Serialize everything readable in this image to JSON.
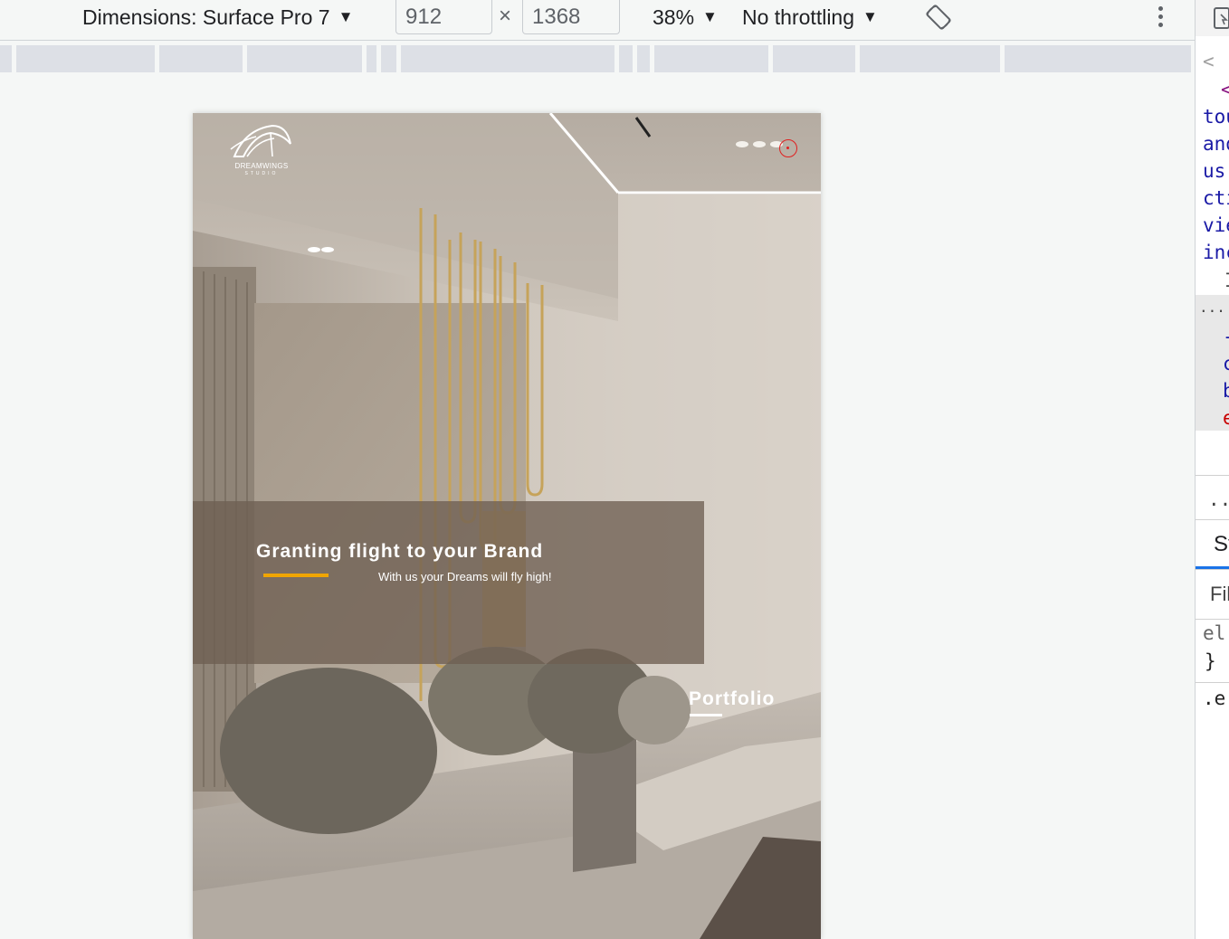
{
  "toolbar": {
    "device_label": "Dimensions: Surface Pro 7",
    "width_value": "912",
    "height_value": "1368",
    "times_symbol": "×",
    "zoom_label": "38%",
    "throttle_label": "No throttling",
    "caret": "▼"
  },
  "page": {
    "logo_text": "DREAMWINGS",
    "logo_subtext": "STUDIO",
    "hero_title": "Granting flight to your Brand",
    "hero_subtitle": "With us your Dreams will fly high!",
    "portfolio_label": "Portfolio",
    "colors": {
      "accent": "#f0a500",
      "overlay": "#6e5f52",
      "text": "#ffffff"
    }
  },
  "devtools_panel": {
    "code_lines": [
      "<",
      "<",
      "tou",
      "and",
      "us",
      "cti",
      "vie",
      "inc",
      "I",
      "...",
      "-",
      "c",
      "b",
      "e"
    ],
    "ellipsis": "..",
    "styles_tab_fragment": "St",
    "filter_placeholder": "Fil",
    "rule_selector_1": "el",
    "rule_close": "}",
    "rule_selector_2": ".e"
  }
}
